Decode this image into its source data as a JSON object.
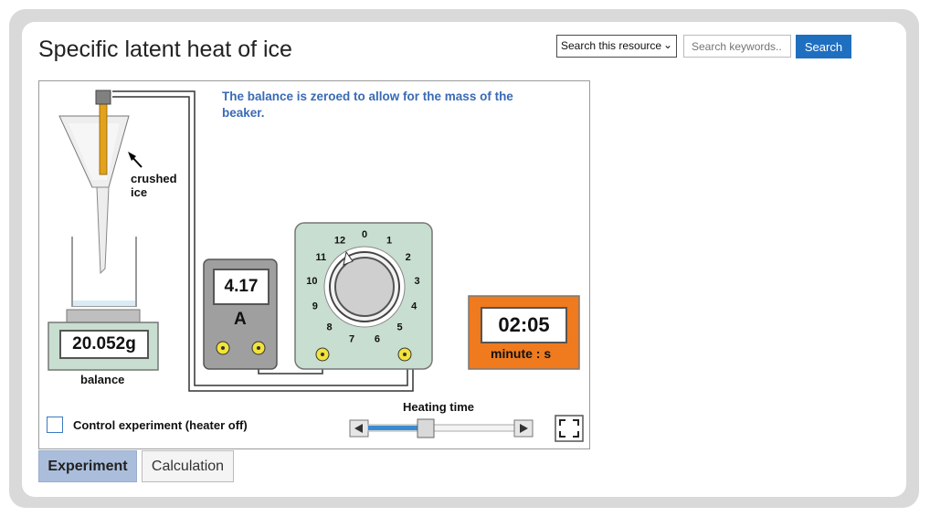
{
  "page": {
    "title": "Specific latent heat of ice"
  },
  "search": {
    "scope_selected": "Search this resource",
    "placeholder": "Search keywords..",
    "button_label": "Search"
  },
  "simulation": {
    "note": "The balance is zeroed to allow for the mass of the beaker.",
    "ice_label_1": "crushed",
    "ice_label_2": "ice",
    "balance_reading": "20.052g",
    "balance_label": "balance",
    "ammeter_reading": "4.17",
    "ammeter_unit": "A",
    "dial_numbers": [
      "0",
      "1",
      "2",
      "3",
      "4",
      "5",
      "6",
      "7",
      "8",
      "9",
      "10",
      "11",
      "12"
    ],
    "timer_reading": "02:05",
    "timer_units": "minute : s",
    "heating_time_label": "Heating time",
    "heating_time_fraction": 0.38,
    "control_experiment_label": "Control experiment (heater off)",
    "control_experiment_checked": false
  },
  "tabs": [
    {
      "label": "Experiment",
      "active": true
    },
    {
      "label": "Calculation",
      "active": false
    }
  ],
  "colors": {
    "accent_blue": "#1f6fc0",
    "note_blue": "#3a6ab5",
    "timer_orange": "#f07a1e",
    "dial_panel": "#c8ded0",
    "meter_grey": "#9f9f9f",
    "balance_green": "#c8ded0",
    "terminal_yellow": "#f2e23a",
    "tab_active": "#aabedc"
  },
  "icons": {
    "dropdown": "chevron-down-icon",
    "slider_left": "arrow-left-icon",
    "slider_right": "arrow-right-icon",
    "fullscreen": "fullscreen-icon"
  }
}
